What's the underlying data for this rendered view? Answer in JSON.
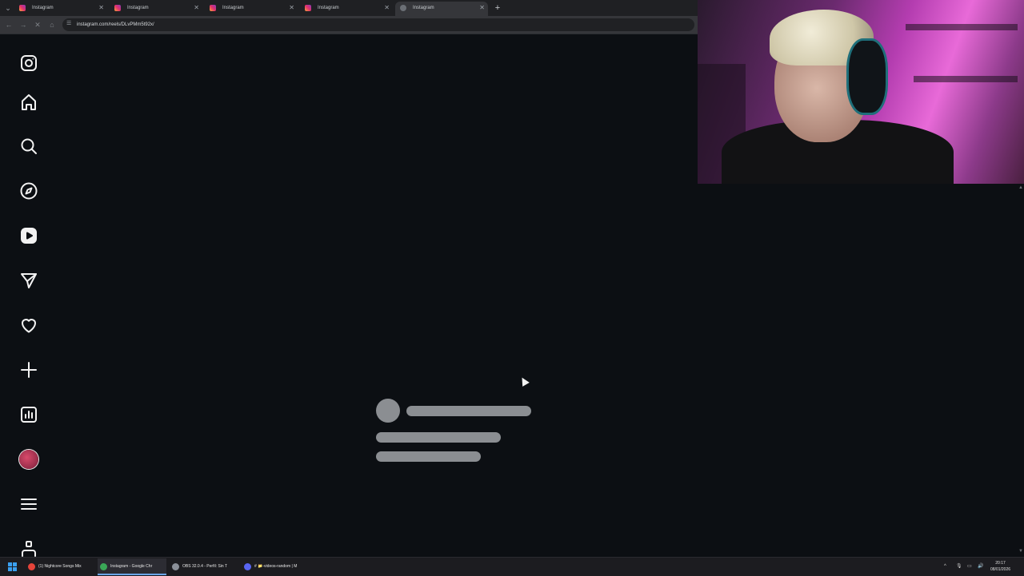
{
  "browser": {
    "tabs": [
      {
        "label": "Instagram",
        "active": false
      },
      {
        "label": "Instagram",
        "active": false
      },
      {
        "label": "Instagram",
        "active": false
      },
      {
        "label": "Instagram",
        "active": false
      },
      {
        "label": "Instagram",
        "active": true
      }
    ],
    "new_tab_label": "+",
    "url": "instagram.com/reels/DLvPMm5t92x/"
  },
  "sidebar": {
    "items": [
      {
        "name": "instagram-logo-icon"
      },
      {
        "name": "home-icon"
      },
      {
        "name": "search-icon"
      },
      {
        "name": "explore-compass-icon"
      },
      {
        "name": "reels-icon"
      },
      {
        "name": "messages-send-icon"
      },
      {
        "name": "notifications-heart-icon"
      },
      {
        "name": "create-plus-icon"
      },
      {
        "name": "dashboard-chart-icon"
      },
      {
        "name": "profile-avatar"
      },
      {
        "name": "more-menu-icon"
      },
      {
        "name": "threads-meta-icon"
      }
    ]
  },
  "loading": {
    "state": "skeleton"
  },
  "taskbar": {
    "apps": [
      {
        "label": "(1) Nightcore Songs Mix",
        "icon_color": "#e5443a",
        "active": false
      },
      {
        "label": "Instagram - Google Chr",
        "icon_color": "#3aa757",
        "active": true
      },
      {
        "label": "OBS 32.0.4 - Perfil: Sin T",
        "icon_color": "#8a8f98",
        "active": false
      },
      {
        "label": "# 📁-videos-random | M",
        "icon_color": "#5865f2",
        "active": false
      }
    ],
    "tray_up": "^",
    "clock_time": "20:17",
    "clock_date": "08/01/2026"
  },
  "colors": {
    "page_bg": "#0c0f13",
    "skeleton": "#8b8e92",
    "tabstrip": "#1f2023",
    "toolbar": "#35363a"
  }
}
